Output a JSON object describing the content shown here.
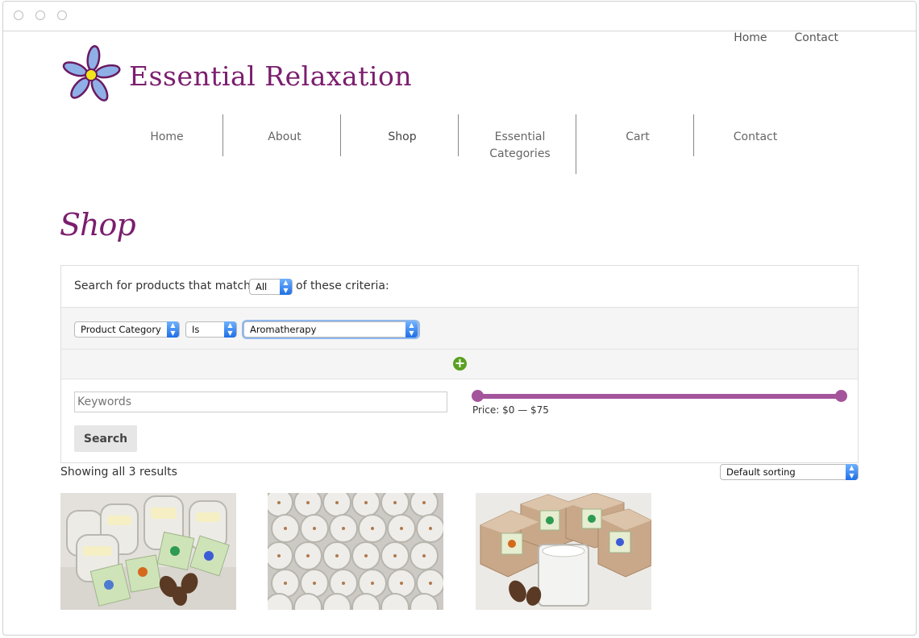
{
  "top_links": [
    "Home",
    "Contact"
  ],
  "brand": {
    "name": "Essential Relaxation"
  },
  "nav": [
    "Home",
    "About",
    "Shop",
    "Essential\nCategories",
    "Cart",
    "Contact"
  ],
  "page_title": "Shop",
  "search": {
    "match_prefix": "Search for products that match",
    "match_value": "All",
    "match_suffix": "of these criteria:",
    "criteria": {
      "field": "Product Category",
      "operator": "Is",
      "value": "Aromatherapy"
    },
    "keywords_placeholder": "Keywords",
    "button_label": "Search",
    "price": {
      "min": 0,
      "max": 75,
      "label": "Price: $0 — $75"
    }
  },
  "results": {
    "count_text": "Showing all 3 results",
    "sorting": "Default sorting"
  },
  "products": [
    "glass-jar-candles",
    "tea-light-candles",
    "boxed-candles"
  ],
  "colors": {
    "brand": "#7b1e6e",
    "slider": "#a4549b",
    "add": "#5aa021"
  },
  "icons": [
    "flower-logo-icon",
    "add-criteria-icon",
    "select-arrow-icon"
  ]
}
